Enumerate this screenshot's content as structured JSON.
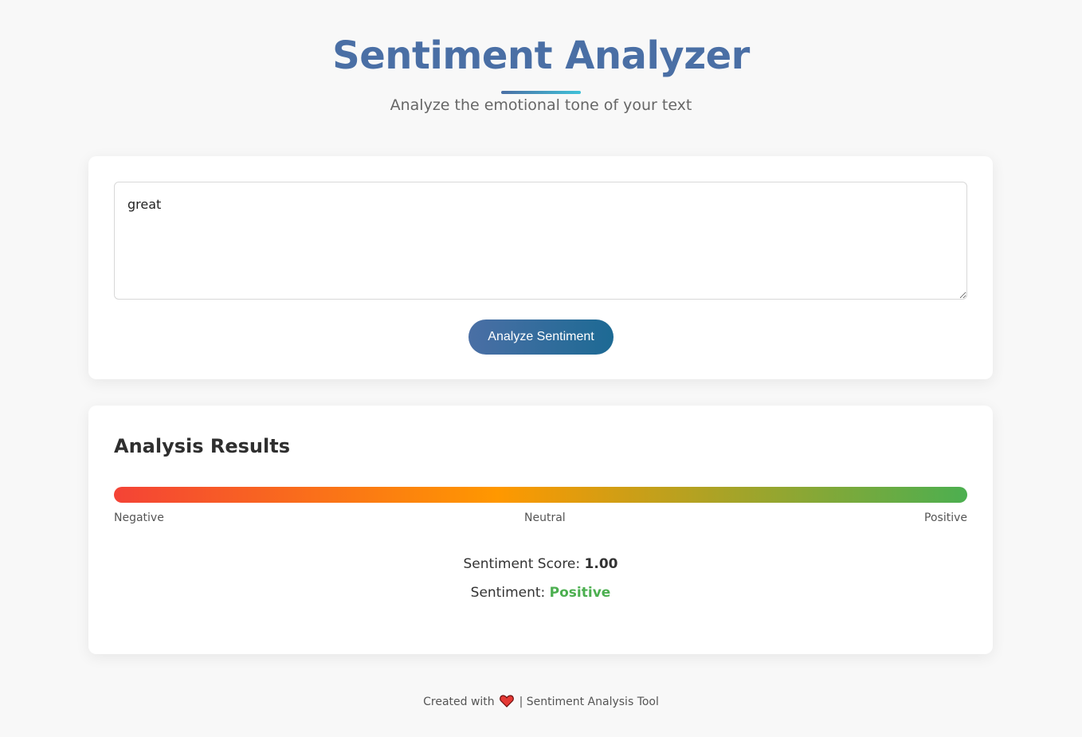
{
  "header": {
    "title": "Sentiment Analyzer",
    "subtitle": "Analyze the emotional tone of your text"
  },
  "input": {
    "text_value": "great",
    "analyze_label": "Analyze Sentiment"
  },
  "results": {
    "title": "Analysis Results",
    "scale_labels": {
      "negative": "Negative",
      "neutral": "Neutral",
      "positive": "Positive"
    },
    "score_label": "Sentiment Score: ",
    "score_value": "1.00",
    "sentiment_label": "Sentiment: ",
    "sentiment_value": "Positive"
  },
  "footer": {
    "prefix": "Created with",
    "heart_icon": "heart-icon",
    "suffix": "| Sentiment Analysis Tool"
  },
  "colors": {
    "title": "#4a6fa5",
    "button_start": "#4a6fa5",
    "button_end": "#1d6a94",
    "gauge_negative": "#f44336",
    "gauge_neutral": "#ff9800",
    "gauge_positive": "#4caf50",
    "sentiment_positive": "#4caf50",
    "heart": "#e53935"
  }
}
